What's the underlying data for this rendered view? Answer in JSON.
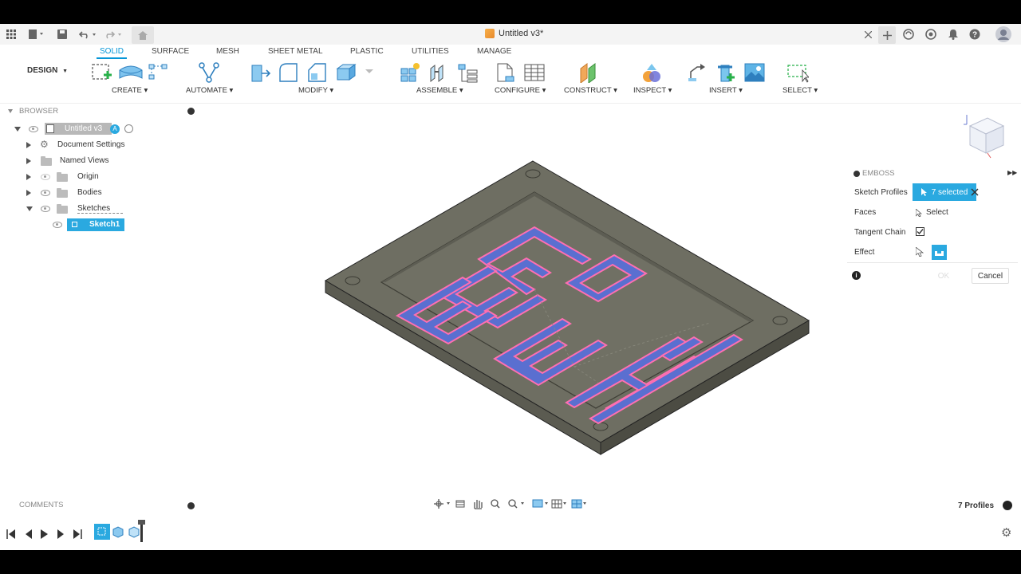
{
  "titlebar": {
    "document_title": "Untitled v3*"
  },
  "ribbon": {
    "design_label": "DESIGN",
    "tabs": [
      "SOLID",
      "SURFACE",
      "MESH",
      "SHEET METAL",
      "PLASTIC",
      "UTILITIES",
      "MANAGE"
    ],
    "groups": {
      "create": "CREATE",
      "automate": "AUTOMATE",
      "modify": "MODIFY",
      "assemble": "ASSEMBLE",
      "configure": "CONFIGURE",
      "construct": "CONSTRUCT",
      "inspect": "INSPECT",
      "insert": "INSERT",
      "select": "SELECT"
    }
  },
  "browser": {
    "header": "BROWSER",
    "root": "Untitled v3",
    "items": [
      "Document Settings",
      "Named Views",
      "Origin",
      "Bodies",
      "Sketches"
    ],
    "sketch": "Sketch1"
  },
  "emboss": {
    "title": "EMBOSS",
    "sketch_profiles_label": "Sketch Profiles",
    "sketch_profiles_value": "7 selected",
    "faces_label": "Faces",
    "faces_value": "Select",
    "tangent_chain_label": "Tangent Chain",
    "tangent_chain_checked": true,
    "effect_label": "Effect",
    "ok_label": "OK",
    "cancel_label": "Cancel"
  },
  "footer": {
    "comments": "COMMENTS",
    "profiles_count": "7 Profiles"
  },
  "colors": {
    "accent": "#0696d7",
    "selected": "#2aa9e0",
    "plate": "#6e6e62",
    "profile_fill": "#5a6fd0",
    "profile_edge": "#ff6fb1"
  }
}
